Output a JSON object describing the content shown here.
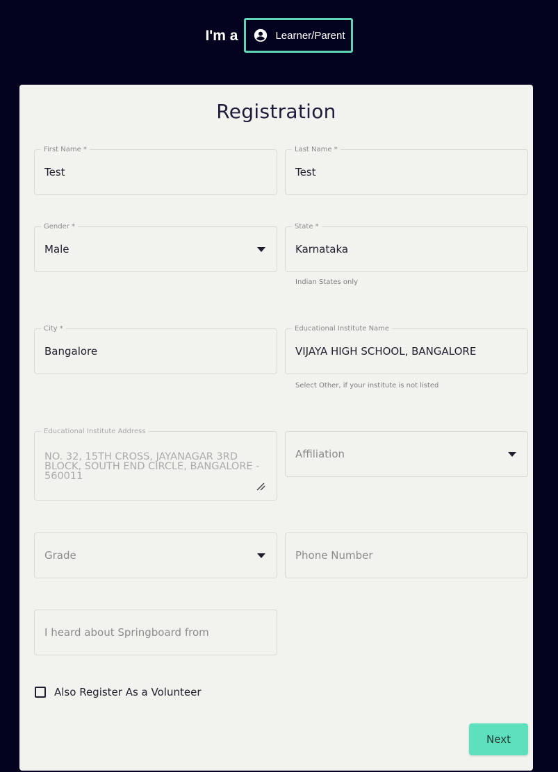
{
  "role_selector": {
    "prefix": "I'm a",
    "button_label": "Learner/Parent",
    "icon": "account-circle-icon"
  },
  "form": {
    "title": "Registration",
    "first_name": {
      "label": "First Name *",
      "value": "Test"
    },
    "last_name": {
      "label": "Last Name *",
      "value": "Test"
    },
    "gender": {
      "label": "Gender *",
      "value": "Male"
    },
    "state": {
      "label": "State *",
      "value": "Karnataka",
      "helper": "Indian States only"
    },
    "city": {
      "label": "City *",
      "value": "Bangalore"
    },
    "institute_name": {
      "label": "Educational Institute Name",
      "value": "VIJAYA HIGH SCHOOL, BANGALORE",
      "helper": "Select Other, if your institute is not listed"
    },
    "institute_address": {
      "label": "Educational Institute Address",
      "value": "NO. 32, 15TH CROSS, JAYANAGAR 3RD BLOCK, SOUTH END CIRCLE, BANGALORE - 560011"
    },
    "affiliation": {
      "placeholder": "Affiliation"
    },
    "grade": {
      "placeholder": "Grade"
    },
    "phone": {
      "placeholder": "Phone Number"
    },
    "heard_about": {
      "placeholder": "I heard about Springboard from"
    },
    "volunteer_checkbox": {
      "label": "Also Register As a Volunteer",
      "checked": false
    },
    "next_label": "Next"
  },
  "colors": {
    "background": "#04031f",
    "card": "#f2f2ef",
    "accent": "#5fe0bd",
    "accent_border": "#5fd7b6"
  }
}
